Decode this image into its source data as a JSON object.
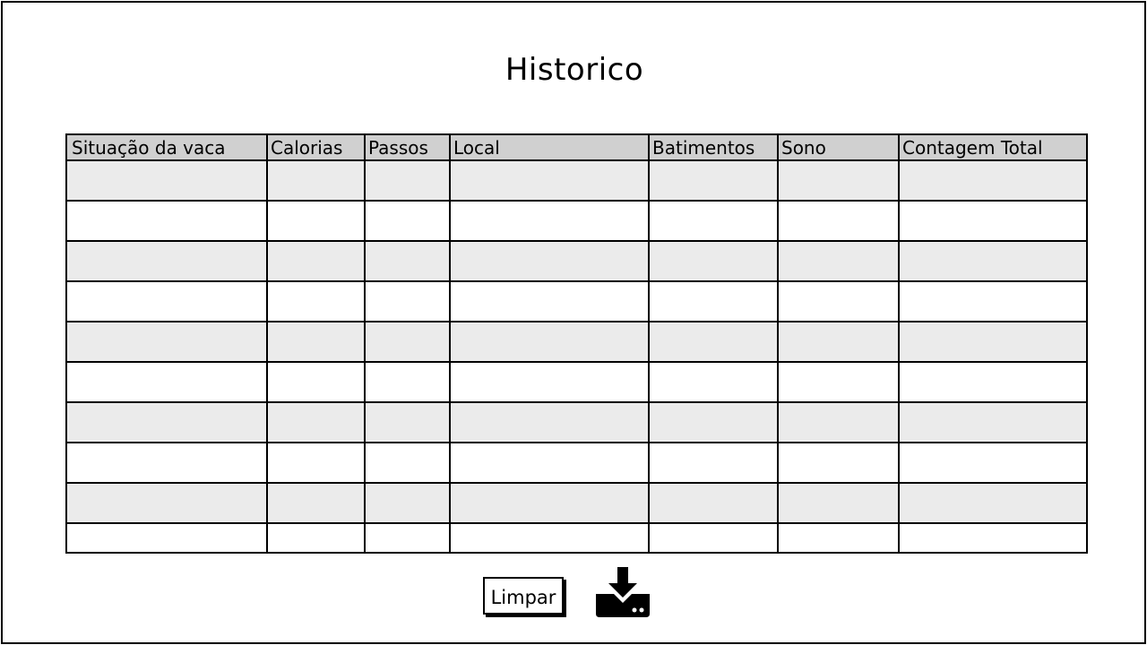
{
  "page": {
    "title": "Historico"
  },
  "table": {
    "columns": [
      "Situação da vaca",
      "Calorias",
      "Passos",
      "Local",
      "Batimentos",
      "Sono",
      "Contagem Total"
    ],
    "rows": [
      [
        "",
        "",
        "",
        "",
        "",
        "",
        ""
      ],
      [
        "",
        "",
        "",
        "",
        "",
        "",
        ""
      ],
      [
        "",
        "",
        "",
        "",
        "",
        "",
        ""
      ],
      [
        "",
        "",
        "",
        "",
        "",
        "",
        ""
      ],
      [
        "",
        "",
        "",
        "",
        "",
        "",
        ""
      ],
      [
        "",
        "",
        "",
        "",
        "",
        "",
        ""
      ],
      [
        "",
        "",
        "",
        "",
        "",
        "",
        ""
      ],
      [
        "",
        "",
        "",
        "",
        "",
        "",
        ""
      ],
      [
        "",
        "",
        "",
        "",
        "",
        "",
        ""
      ],
      [
        "",
        "",
        "",
        "",
        "",
        "",
        ""
      ]
    ]
  },
  "actions": {
    "clear_label": "Limpar",
    "download_icon": "download-icon"
  }
}
